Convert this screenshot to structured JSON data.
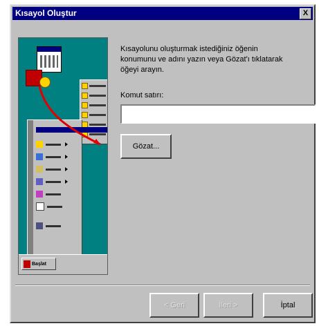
{
  "window": {
    "title": "Kısayol Oluştur",
    "close_glyph": "X"
  },
  "dialog": {
    "instructions": "Kısayolunu oluşturmak istediğiniz öğenin konumunu ve adını yazın veya Gözat'ı tıklatarak öğeyi arayın.",
    "command_line_label": "Komut satırı:",
    "command_line_value": "",
    "browse_label": "Gözat..."
  },
  "buttons": {
    "back_label": "< Geri",
    "next_label": "İleri >",
    "cancel_label": "İptal"
  },
  "illustration": {
    "start_button_label": "Başlat"
  },
  "icons": {
    "close": "close-icon",
    "calendar": "calendar-icon",
    "program": "program-icon",
    "folder": "folder-icon"
  },
  "colors": {
    "titlebar": "#000080",
    "face": "#c0c0c0",
    "desktop": "#008080"
  }
}
